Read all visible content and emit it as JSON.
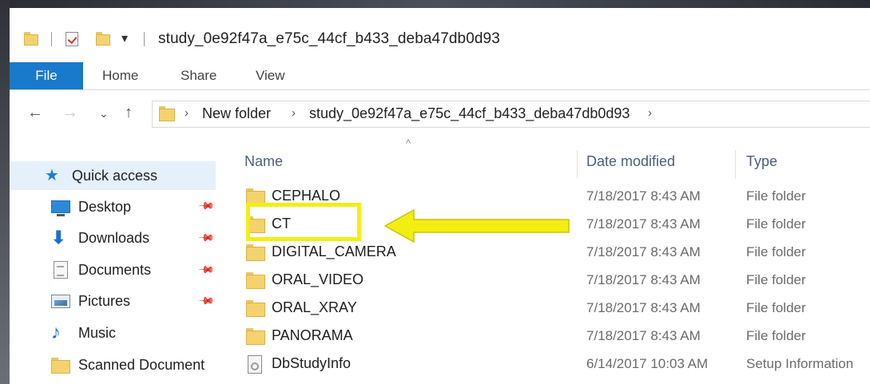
{
  "titlebar": {
    "title": "study_0e92f47a_e75c_44cf_b433_deba47db0d93",
    "dropdown_glyph": "▾"
  },
  "ribbon": {
    "tabs": [
      {
        "label": "File"
      },
      {
        "label": "Home"
      },
      {
        "label": "Share"
      },
      {
        "label": "View"
      }
    ]
  },
  "nav": {
    "back_glyph": "←",
    "forward_glyph": "→",
    "recent_glyph": "⌄",
    "up_glyph": "↑",
    "crumb_sep": "›",
    "breadcrumbs": [
      "New folder",
      "study_0e92f47a_e75c_44cf_b433_deba47db0d93"
    ]
  },
  "sidebar": {
    "quick_access_label": "Quick access",
    "pin_glyph": "📌",
    "items": [
      {
        "label": "Desktop",
        "icon": "desktop-icon",
        "pinned": true
      },
      {
        "label": "Downloads",
        "icon": "download-icon",
        "pinned": true
      },
      {
        "label": "Documents",
        "icon": "documents-icon",
        "pinned": true
      },
      {
        "label": "Pictures",
        "icon": "pictures-icon",
        "pinned": true
      },
      {
        "label": "Music",
        "icon": "music-icon",
        "pinned": false
      },
      {
        "label": "Scanned Document",
        "icon": "folder-icon",
        "pinned": false
      }
    ]
  },
  "filelist": {
    "sort_glyph": "^",
    "columns": {
      "name": "Name",
      "date": "Date modified",
      "type": "Type"
    },
    "rows": [
      {
        "name": "CEPHALO",
        "date": "7/18/2017 8:43 AM",
        "type": "File folder"
      },
      {
        "name": "CT",
        "date": "7/18/2017 8:43 AM",
        "type": "File folder"
      },
      {
        "name": "DIGITAL_CAMERA",
        "date": "7/18/2017 8:43 AM",
        "type": "File folder"
      },
      {
        "name": "ORAL_VIDEO",
        "date": "7/18/2017 8:43 AM",
        "type": "File folder"
      },
      {
        "name": "ORAL_XRAY",
        "date": "7/18/2017 8:43 AM",
        "type": "File folder"
      },
      {
        "name": "PANORAMA",
        "date": "7/18/2017 8:43 AM",
        "type": "File folder"
      },
      {
        "name": "DbStudyInfo",
        "date": "6/14/2017 10:03 AM",
        "type": "Setup Information"
      }
    ]
  },
  "annotation": {
    "highlight_color": "#f3ee12",
    "target": "CT"
  },
  "colors": {
    "file_tab": "#1979ca",
    "selection": "#e5f0fb",
    "folder": "#f4d26e"
  }
}
